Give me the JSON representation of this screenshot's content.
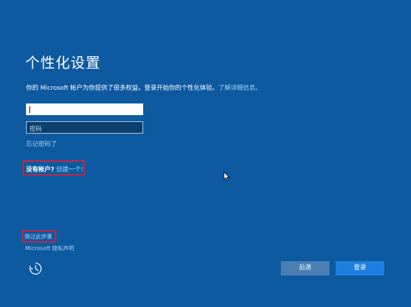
{
  "page": {
    "title": "个性化设置",
    "description": "你的 Microsoft 帐户为你提供了很多权益。登录开始你的个性化体验。",
    "learn_more": "了解详细信息。"
  },
  "form": {
    "email_value": "",
    "password_placeholder": "密码",
    "forgot_password": "忘记密码了"
  },
  "account": {
    "no_account": "没有帐户?",
    "create_link": "创建一个!"
  },
  "footer": {
    "skip_step": "跳过此步骤",
    "privacy": "Microsoft 隐私声明"
  },
  "buttons": {
    "back": "后退",
    "login": "登录"
  },
  "colors": {
    "background": "#0e5aa1",
    "link": "#a9d2f5",
    "highlight_border": "#d0223a",
    "login_button": "#1f7fe0",
    "back_button": "#4a7fb4"
  },
  "icons": {
    "ease_of_access": "ease-of-access-icon",
    "cursor": "mouse-cursor-icon"
  }
}
